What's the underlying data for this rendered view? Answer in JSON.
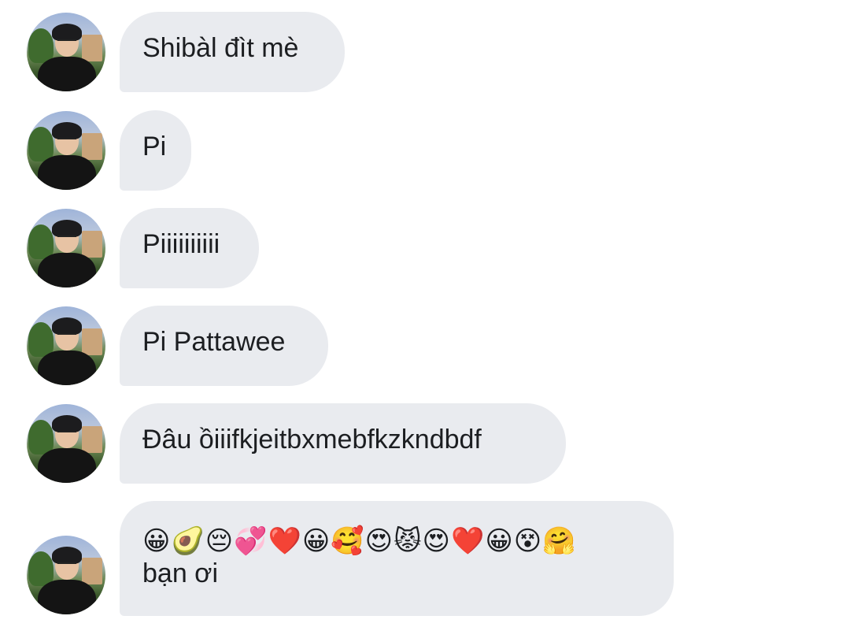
{
  "messages": [
    {
      "text": "Shibàl đìt mè"
    },
    {
      "text": "Pi"
    },
    {
      "text": "Piiiiiiiiii"
    },
    {
      "text": "Pi Pattawee"
    },
    {
      "text": "Đâu ồiiifkjeitbxmebfkzkndbdf"
    },
    {
      "emojis": "😀🥑😔💞❤️😀🥰😍😾😍❤️😀😵🤗",
      "text": "bạn ơi"
    }
  ],
  "avatar_icon": "profile-photo"
}
